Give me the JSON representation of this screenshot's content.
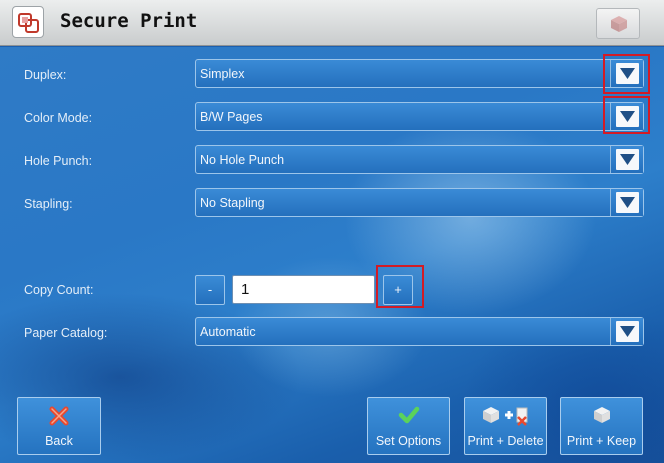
{
  "header": {
    "title": "Secure Print",
    "app_icon": "secure-print-icon",
    "right_button_icon": "cube-icon"
  },
  "settings": {
    "duplex": {
      "label": "Duplex:",
      "value": "Simplex"
    },
    "color_mode": {
      "label": "Color Mode:",
      "value": "B/W Pages"
    },
    "hole_punch": {
      "label": "Hole Punch:",
      "value": "No Hole Punch"
    },
    "stapling": {
      "label": "Stapling:",
      "value": "No Stapling"
    },
    "copy_count": {
      "label": "Copy Count:",
      "value": "1",
      "minus": "-",
      "plus": "+"
    },
    "paper_catalog": {
      "label": "Paper Catalog:",
      "value": "Automatic"
    }
  },
  "footer": {
    "back": {
      "label": "Back",
      "icon": "x-icon"
    },
    "set_options": {
      "label": "Set Options",
      "icon": "checkmark-icon"
    },
    "print_delete": {
      "label": "Print + Delete",
      "icon": "print-delete-icon"
    },
    "print_keep": {
      "label": "Print + Keep",
      "icon": "print-keep-icon"
    }
  },
  "colors": {
    "highlight": "#d31b25",
    "accent_blue": "#2a78c6",
    "title_bar": "#dcdfe0"
  }
}
